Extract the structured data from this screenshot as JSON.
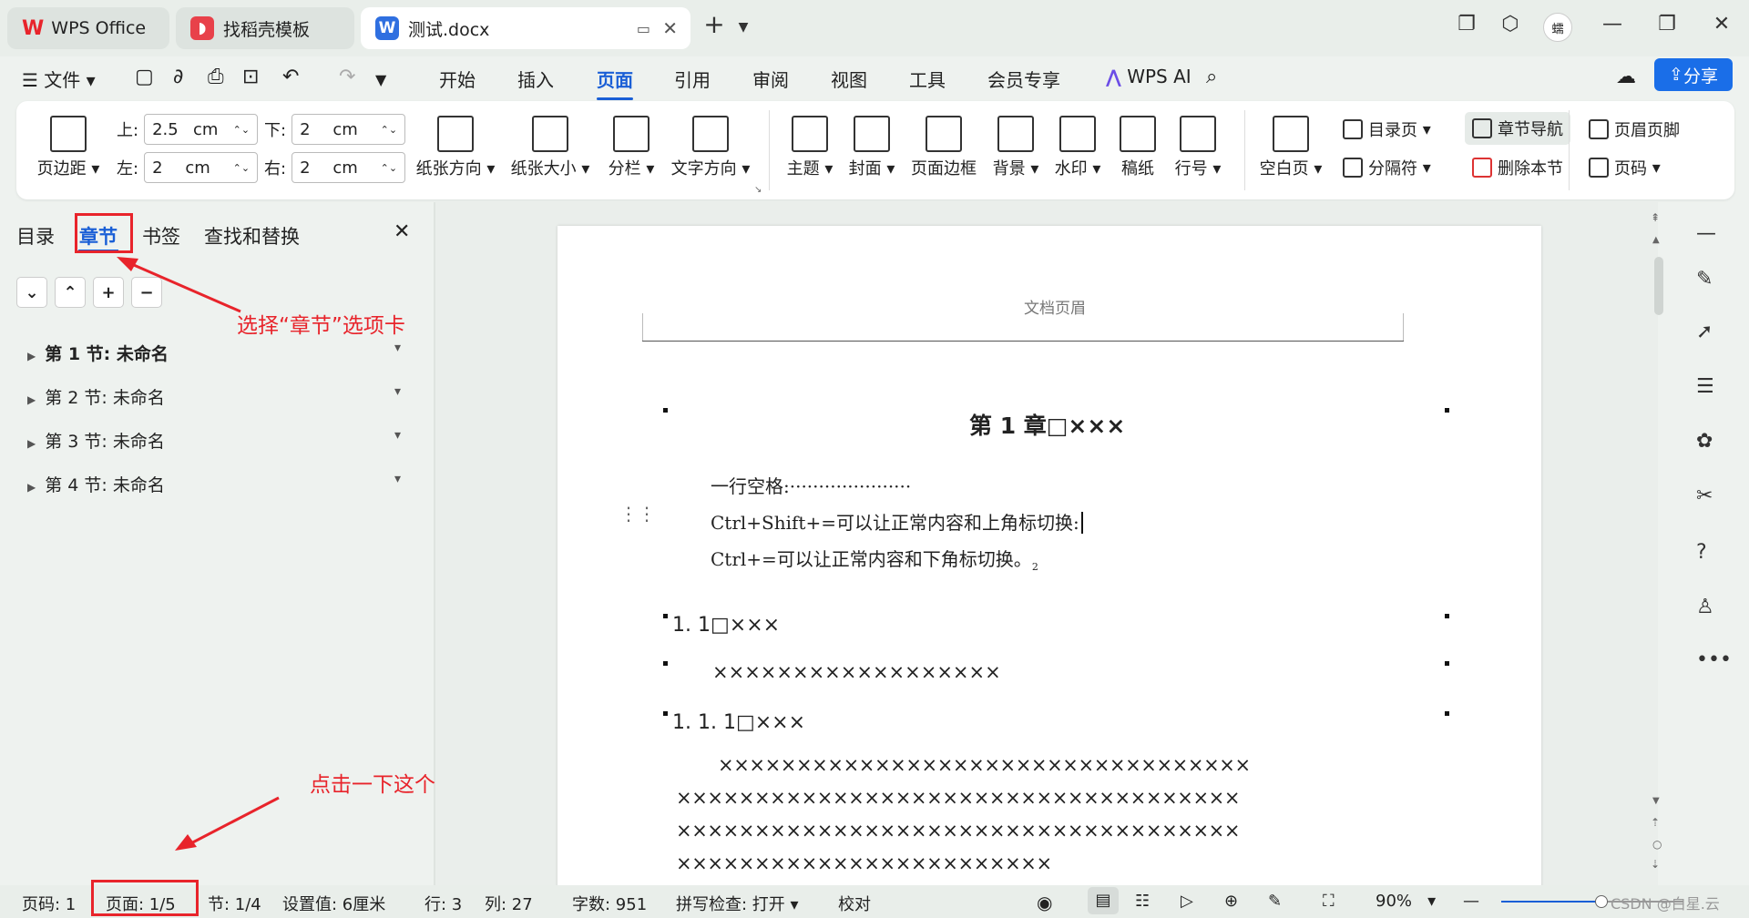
{
  "tabs": [
    {
      "label": "WPS Office"
    },
    {
      "label": "找稻壳模板"
    },
    {
      "label": "测试.docx"
    }
  ],
  "window": {
    "avatar": "蠕"
  },
  "menu": {
    "file": "文件",
    "items": [
      "开始",
      "插入",
      "页面",
      "引用",
      "审阅",
      "视图",
      "工具",
      "会员专享"
    ],
    "active": "页面",
    "ai": "WPS AI",
    "share": "分享"
  },
  "ribbon": {
    "margins_btn": "页边距",
    "top_label": "上:",
    "top_val": "2.5",
    "top_unit": "cm",
    "bottom_label": "下:",
    "bottom_val": "2",
    "bottom_unit": "cm",
    "left_label": "左:",
    "left_val": "2",
    "left_unit": "cm",
    "right_label": "右:",
    "right_val": "2",
    "right_unit": "cm",
    "buttons": [
      "纸张方向",
      "纸张大小",
      "分栏",
      "文字方向",
      "主题",
      "封面",
      "页面边框",
      "背景",
      "水印",
      "稿纸",
      "行号",
      "空白页"
    ],
    "toc_page": "目录页",
    "section_nav": "章节导航",
    "separator": "分隔符",
    "delete_section": "删除本节",
    "header_footer": "页眉页脚",
    "page_num": "页码"
  },
  "nav": {
    "tabs": [
      "目录",
      "章节",
      "书签",
      "查找和替换"
    ],
    "sections": [
      "第 1 节: 未命名",
      "第 2 节: 未命名",
      "第 3 节: 未命名",
      "第 4 节: 未命名"
    ]
  },
  "doc": {
    "header": "文档页眉",
    "chapter": "第 1 章□×××",
    "line1": "一行空格:·····················",
    "line2": "Ctrl+Shift+=可以让正常内容和上角标切换:",
    "line3": "Ctrl+=可以让正常内容和下角标切换。",
    "line3_sub": "2",
    "h2": "1. 1□×××",
    "p1": "××××××××××××××××××",
    "h3": "1. 1. 1□×××",
    "p2_l1": "××××××××××××××××××××××××××××××××××",
    "p2_l2": "××××××××××××××××××××××××××××××××××××",
    "p2_l3": "××××××××××××××××××××××××××××××××××××",
    "p2_l4": "××××××××××××××××××××××××"
  },
  "status": {
    "page_code": "页码: 1",
    "page": "页面: 1/5",
    "section": "节: 1/4",
    "setting": "设置值: 6厘米",
    "row": "行: 3",
    "col": "列: 27",
    "words": "字数: 951",
    "spell": "拼写检查: 打开",
    "proof": "校对",
    "zoom": "90%",
    "zoom_fraction": 0.55
  },
  "watermark": "CSDN @白星.云",
  "annotations": {
    "select_tab": "选择“章节”选项卡",
    "click_this": "点击一下这个"
  },
  "colors": {
    "accent": "#1a5fd6",
    "annotation": "#e8242b",
    "share_bg": "#1a6ee8"
  }
}
